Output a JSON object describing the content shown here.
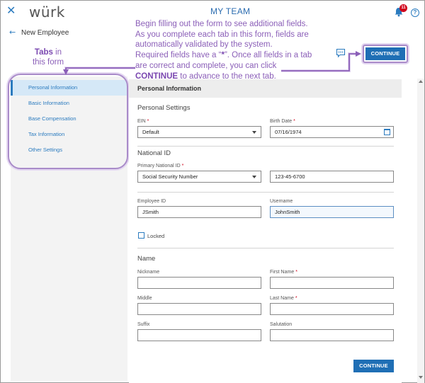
{
  "topbar": {
    "logo": "würk",
    "title": "MY TEAM",
    "notifications_count": "11",
    "help_label": "?"
  },
  "page": {
    "heading": "New Employee"
  },
  "annotation": {
    "line1": "Begin filling out the form to see additional fields.",
    "line2": "As you complete each tab in this form, fields are",
    "line3": "automatically validated by the system.",
    "line4_pre": "Required fields have a “",
    "line4_star": "*",
    "line4_post": "”. Once all fields in a tab",
    "line5": "are correct and complete, you can click",
    "line6_bold": "CONTINUE",
    "line6_post": " to advance to the next tab.",
    "tabs_bold": "Tabs",
    "tabs_in": " in",
    "tabs_line2": "this form"
  },
  "sidebar": {
    "items": [
      {
        "label": "Personal Information",
        "active": true
      },
      {
        "label": "Basic Information",
        "active": false
      },
      {
        "label": "Base Compensation",
        "active": false
      },
      {
        "label": "Tax Information",
        "active": false
      },
      {
        "label": "Other Settings",
        "active": false
      }
    ]
  },
  "form": {
    "section_title": "Personal Information",
    "personal_settings": "Personal Settings",
    "ein_label": "EIN",
    "ein_value": "Default",
    "birth_label": "Birth Date",
    "birth_value": "07/16/1974",
    "national_id": "National ID",
    "primary_id_label": "Primary National ID",
    "primary_id_value": "Social Security Number",
    "ssn_value": "123-45-6700",
    "employee_id_label": "Employee ID",
    "employee_id_value": "JSmith",
    "username_label": "Username",
    "username_value": "JohnSmith",
    "locked_label": "Locked",
    "name_heading": "Name",
    "nickname_label": "Nickname",
    "first_name_label": "First Name",
    "middle_label": "Middle",
    "last_name_label": "Last Name",
    "suffix_label": "Suffix",
    "salutation_label": "Salutation",
    "required_mark": "*"
  },
  "buttons": {
    "continue_top": "CONTINUE",
    "continue_bottom": "CONTINUE"
  },
  "colors": {
    "accent": "#1f6fb5",
    "annotation": "#8b5fb8",
    "required": "#d0021b"
  }
}
